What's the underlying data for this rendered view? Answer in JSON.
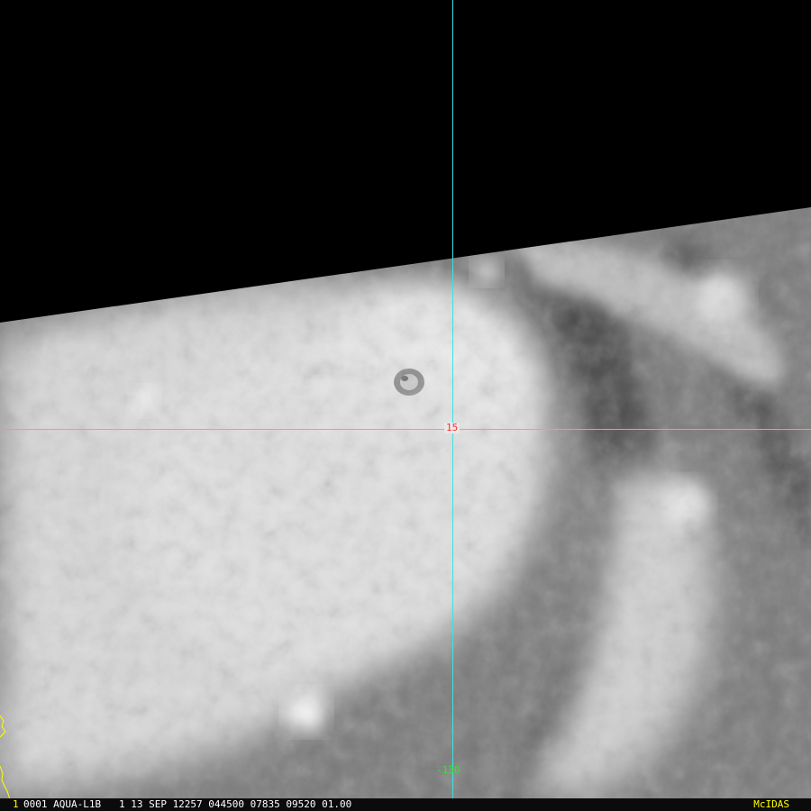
{
  "image": {
    "description_colors": {
      "background": "#000000",
      "gridline": "#40e0e0",
      "lat_label": "#ff3030",
      "lon_label": "#33e533",
      "status_text": "#ffffff",
      "brand": "#ffff00"
    }
  },
  "grid": {
    "latitude_label": "15",
    "longitude_label": "-130"
  },
  "status_bar": {
    "frame": "1",
    "text": "0001 AQUA-L1B   1 13 SEP 12257 044500 07835 09520 01.00",
    "brand": "McIDAS"
  }
}
